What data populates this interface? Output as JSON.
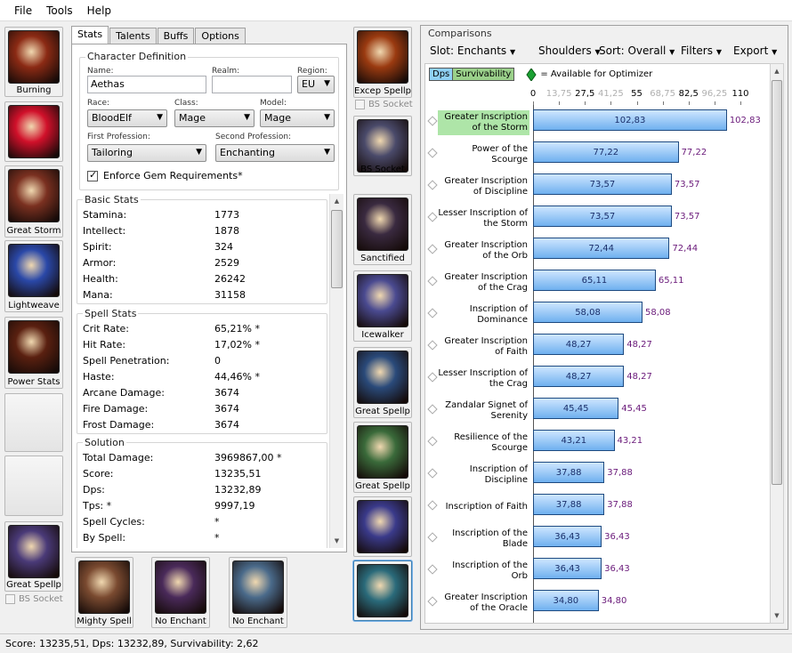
{
  "menu": [
    "File",
    "Tools",
    "Help"
  ],
  "left_slots": [
    {
      "label": "Burning",
      "icon": "shoulder-armor-icon",
      "color": "#8b2a14"
    },
    {
      "label": "",
      "icon": "red-gem-icon",
      "color": "#d0102a"
    },
    {
      "label": "Great Storm",
      "icon": "belt-icon",
      "color": "#7a3020"
    },
    {
      "label": "Lightweave",
      "icon": "blue-cloak-icon",
      "color": "#2a48a8"
    },
    {
      "label": "Power Stats",
      "icon": "chest-robe-icon",
      "color": "#5a2010"
    },
    {
      "label": "",
      "icon": "empty-slot-icon",
      "color": ""
    },
    {
      "label": "",
      "icon": "empty-slot-icon",
      "color": ""
    },
    {
      "label": "Great Spellp",
      "icon": "bracer-icon",
      "color": "#4a3a78"
    }
  ],
  "left_socket": "BS Socket",
  "mid_slots": [
    {
      "label": "Excep Spellp",
      "icon": "gloves-icon",
      "color": "#9a3a10"
    },
    {
      "label": "BS Socket",
      "icon": "belt-buckle-icon",
      "color": "#4a4a6a"
    },
    {
      "label": "Sanctified",
      "icon": "pants-icon",
      "color": "#3a2a40"
    },
    {
      "label": "Icewalker",
      "icon": "boots-icon",
      "color": "#4a4a90"
    },
    {
      "label": "Great Spellp",
      "icon": "ring-icon",
      "color": "#2a4a7a"
    },
    {
      "label": "Great Spellp",
      "icon": "ring-jade-icon",
      "color": "#3a6a3a"
    },
    {
      "label": "",
      "icon": "trinket-shard-icon",
      "color": "#3a3a8a"
    },
    {
      "label": "",
      "icon": "trinket-claw-icon",
      "color": "#2a6a7a"
    }
  ],
  "mid_socket": "BS Socket",
  "bottom_slots": [
    {
      "label": "Mighty Spell",
      "icon": "portrait-icon",
      "color": "#7a4a30"
    },
    {
      "label": "No Enchant",
      "icon": "wand-icon",
      "color": "#4a2a5a"
    },
    {
      "label": "No Enchant",
      "icon": "crystal-weapon-icon",
      "color": "#4a6a8a"
    }
  ],
  "tabs": [
    "Stats",
    "Talents",
    "Buffs",
    "Options"
  ],
  "char": {
    "title": "Character Definition",
    "name_label": "Name:",
    "name": "Aethas",
    "realm_label": "Realm:",
    "realm": "",
    "region_label": "Region:",
    "region": "EU",
    "race_label": "Race:",
    "race": "BloodElf",
    "class_label": "Class:",
    "class": "Mage",
    "model_label": "Model:",
    "model": "Mage",
    "prof1_label": "First Profession:",
    "prof1": "Tailoring",
    "prof2_label": "Second Profession:",
    "prof2": "Enchanting",
    "enforce": "Enforce Gem Requirements*"
  },
  "basic": {
    "title": "Basic Stats",
    "rows": [
      {
        "k": "Stamina:",
        "v": "1773"
      },
      {
        "k": "Intellect:",
        "v": "1878"
      },
      {
        "k": "Spirit:",
        "v": "324"
      },
      {
        "k": "Armor:",
        "v": "2529"
      },
      {
        "k": "Health:",
        "v": "26242"
      },
      {
        "k": "Mana:",
        "v": "31158"
      }
    ]
  },
  "spell": {
    "title": "Spell Stats",
    "rows": [
      {
        "k": "Crit Rate:",
        "v": "65,21% *"
      },
      {
        "k": "Hit Rate:",
        "v": "17,02% *"
      },
      {
        "k": "Spell Penetration:",
        "v": "0"
      },
      {
        "k": "Haste:",
        "v": "44,46% *"
      },
      {
        "k": "Arcane Damage:",
        "v": "3674"
      },
      {
        "k": "Fire Damage:",
        "v": "3674"
      },
      {
        "k": "Frost Damage:",
        "v": "3674"
      }
    ]
  },
  "solution": {
    "title": "Solution",
    "rows": [
      {
        "k": "Total Damage:",
        "v": "3969867,00 *"
      },
      {
        "k": "Score:",
        "v": "13235,51"
      },
      {
        "k": "Dps:",
        "v": "13232,89"
      },
      {
        "k": "Tps: *",
        "v": "9997,19"
      },
      {
        "k": "Spell Cycles:",
        "v": "*"
      },
      {
        "k": "By Spell:",
        "v": "*"
      }
    ]
  },
  "comparisons": {
    "title": "Comparisons",
    "slot": "Slot: Enchants",
    "subslot": "Shoulders",
    "sort": "Sort: Overall",
    "filters": "Filters",
    "export": "Export",
    "legend_dps": "Dps",
    "legend_surv": "Survivability",
    "legend_avail": "= Available for Optimizer",
    "colors": {
      "dps": "#8fd0f5",
      "surv": "#9ad08a",
      "avail": "#1aa032"
    }
  },
  "chart_data": {
    "type": "bar",
    "ticks": [
      "0",
      "13,75",
      "27,5",
      "41,25",
      "55",
      "68,75",
      "82,5",
      "96,25",
      "110"
    ],
    "tick_values": [
      0,
      13.75,
      27.5,
      41.25,
      55,
      68.75,
      82.5,
      96.25,
      110
    ],
    "xlim": [
      0,
      110
    ],
    "categories": [
      "Greater Inscription of the Storm",
      "Power of the Scourge",
      "Greater Inscription of Discipline",
      "Lesser Inscription of the Storm",
      "Greater Inscription of the Orb",
      "Greater Inscription of the Crag",
      "Inscription of Dominance",
      "Greater Inscription of Faith",
      "Lesser Inscription of the Crag",
      "Zandalar Signet of Serenity",
      "Resilience of the Scourge",
      "Inscription of Discipline",
      "Inscription of Faith",
      "Inscription of the Blade",
      "Inscription of the Orb",
      "Greater Inscription of the Oracle"
    ],
    "values": [
      102.83,
      77.22,
      73.57,
      73.57,
      72.44,
      65.11,
      58.08,
      48.27,
      48.27,
      45.45,
      43.21,
      37.88,
      37.88,
      36.43,
      36.43,
      34.8
    ],
    "labels": [
      "102,83",
      "77,22",
      "73,57",
      "73,57",
      "72,44",
      "65,11",
      "58,08",
      "48,27",
      "48,27",
      "45,45",
      "43,21",
      "37,88",
      "37,88",
      "36,43",
      "36,43",
      "34,80"
    ]
  },
  "status": "Score: 13235,51, Dps: 13232,89, Survivability: 2,62"
}
